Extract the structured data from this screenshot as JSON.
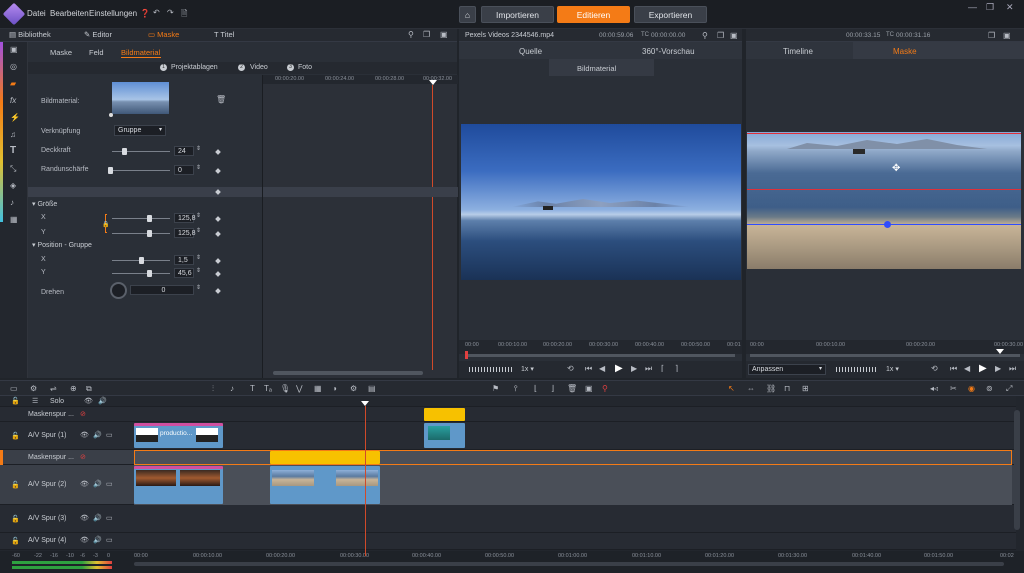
{
  "menu": {
    "datei": "Datei",
    "bearbeiten": "Bearbeiten",
    "einstellungen": "Einstellungen"
  },
  "nav": {
    "importieren": "Importieren",
    "editieren": "Editieren",
    "exportieren": "Exportieren"
  },
  "colors": {
    "accent": "#f47b16",
    "mask_line": "#e0303a",
    "handle": "#2f4cff",
    "clip_yellow": "#f7c100",
    "clip_blue": "#5f98c9",
    "clip_pink": "#d04fa0"
  },
  "lib_tabs": {
    "bibliothek": "Bibliothek",
    "editor": "Editor",
    "maske": "Maske",
    "titel": "Titel"
  },
  "sub_tabs": {
    "maske": "Maske",
    "feld": "Feld",
    "bildmaterial": "Bildmaterial"
  },
  "sections": {
    "s1_num": "1",
    "s1": "Projektablagen",
    "s2_num": "2",
    "s2": "Video",
    "s3_num": "3",
    "s3": "Foto"
  },
  "props": {
    "bildmaterial": "Bildmaterial:",
    "verknuepfung": "Verknüpfung",
    "verknuepfung_val": "Gruppe",
    "deckkraft": "Deckkraft",
    "deckkraft_val": "24",
    "randunschaerfe": "Randunschärfe",
    "randunschaerfe_val": "0",
    "groesse": "Größe",
    "x": "X",
    "x_val": "125,8",
    "y": "Y",
    "y_val": "125,8",
    "position": "Position - Gruppe",
    "px": "X",
    "px_val": "1,5",
    "py": "Y",
    "py_val": "45,6",
    "drehen": "Drehen",
    "drehen_val": "0"
  },
  "kf_ruler": [
    "00:00:20.00",
    "00:00:24.00",
    "00:00:28.00",
    "00:00:32.00"
  ],
  "preview1": {
    "title": "Pexels Videos 2344546.mp4",
    "dur": "00:00:59.06",
    "tc_label": "TC",
    "tc": "00:00:00.00",
    "tab_quelle": "Quelle",
    "tab_360": "360°-Vorschau",
    "tab_bild": "Bildmaterial",
    "ruler": [
      "00:00",
      "00:00:10.00",
      "00:00:20.00",
      "00:00:30.00",
      "00:00:40.00",
      "00:00:50.00",
      "00:01"
    ],
    "speed": "1x"
  },
  "preview2": {
    "dur": "00:00:33.15",
    "tc_label": "TC",
    "tc": "00:00:31.16",
    "tab_timeline": "Timeline",
    "tab_maske": "Maske",
    "ruler": [
      "00:00",
      "00:00:10.00",
      "00:00:20.00",
      "00:00:30.00"
    ],
    "fit": "Anpassen",
    "speed": "1x"
  },
  "tracks": {
    "solo": "Solo",
    "m1": "Maskenspur ...",
    "av1": "A/V Spur (1)",
    "m2": "Maskenspur ...",
    "av2": "A/V Spur (2)",
    "av3": "A/V Spur (3)",
    "av4": "A/V Spur (4)"
  },
  "clip_label": "productio...",
  "tl_ruler": [
    "00:00",
    "00:00:10.00",
    "00:00:20.00",
    "00:00:30.00",
    "00:00:40.00",
    "00:00:50.00",
    "00:01:00.00",
    "00:01:10.00",
    "00:01:20.00",
    "00:01:30.00",
    "00:01:40.00",
    "00:01:50.00",
    "00:02"
  ],
  "meter": [
    "-60",
    "-22",
    "-16",
    "-10",
    "-6",
    "-3",
    "0"
  ]
}
